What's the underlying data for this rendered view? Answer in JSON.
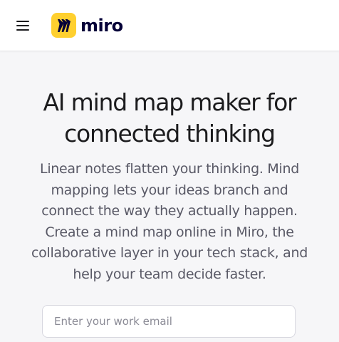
{
  "header": {
    "menu_icon": "hamburger-menu-icon",
    "logo_icon": "miro-logo-icon",
    "logo_text": "miro",
    "logo_color": "#ffd02f"
  },
  "hero": {
    "title_lines": [
      "AI mind map maker for",
      "connected thinking"
    ],
    "description_lines": [
      "Linear notes flatten your thinking. Mind",
      "mapping lets your ideas branch and",
      "connect the way they actually happen.",
      "Create a mind map online in Miro, the",
      "collaborative layer in your tech stack, and",
      "help your team decide faster."
    ]
  },
  "signup": {
    "email_placeholder": "Enter your work email",
    "email_value": ""
  }
}
